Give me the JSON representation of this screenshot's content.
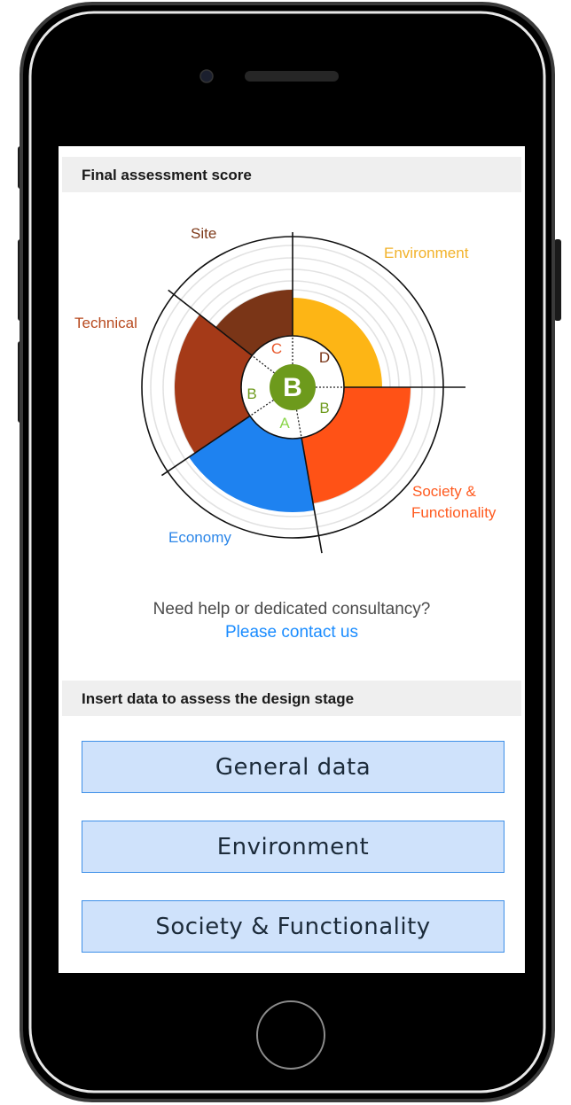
{
  "header1": {
    "title": "Final assessment score"
  },
  "header2": {
    "title": "Insert data to assess the design stage"
  },
  "help": {
    "text": "Need help or dedicated consultancy?",
    "link": "Please contact us"
  },
  "buttons": [
    {
      "label": "General data"
    },
    {
      "label": "Environment"
    },
    {
      "label": "Society & Functionality"
    }
  ],
  "chart_data": {
    "type": "polar-area",
    "overall_grade": "B",
    "categories": [
      {
        "name": "Environment",
        "grade": "D",
        "color": "#FDB515"
      },
      {
        "name": "Society &",
        "name2": "Functionality",
        "grade": "B",
        "color": "#FF5216"
      },
      {
        "name": "Economy",
        "grade": "A",
        "color": "#1E82F0"
      },
      {
        "name": "Technical",
        "grade": "B",
        "color": "#A53A18"
      },
      {
        "name": "Site",
        "grade": "C",
        "color": "#7A3517"
      }
    ],
    "label_colors": {
      "Environment": "#F2B22A",
      "Society": "#FF5A1F",
      "Economy": "#2B86E8",
      "Technical": "#B84A1F",
      "Site": "#7E3A1A",
      "grade_D": "#7A3517",
      "grade_B": "#6E9A1C",
      "grade_A": "#8BD64B",
      "grade_C": "#E8582B"
    },
    "center_color": "#6D9A1C"
  }
}
